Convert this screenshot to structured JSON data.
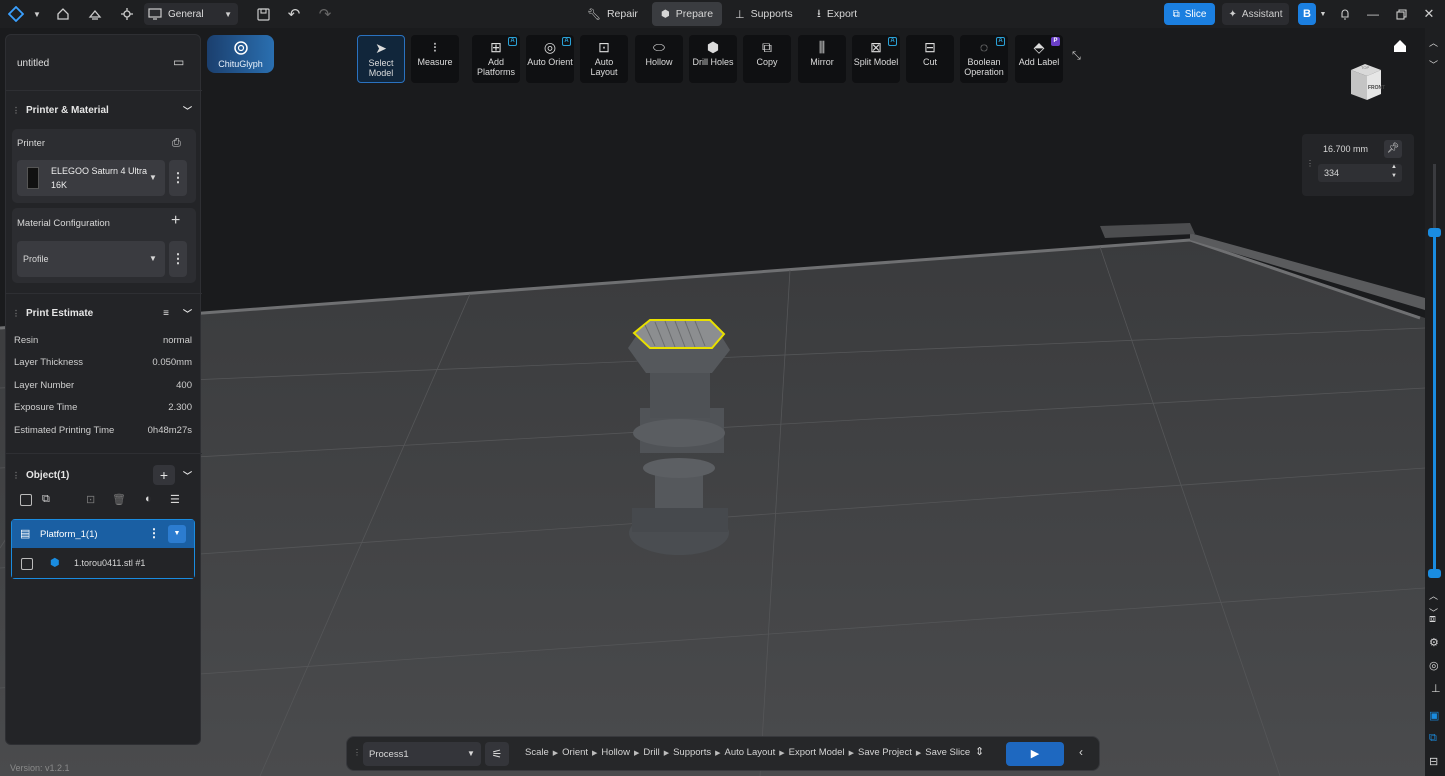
{
  "topbar": {
    "workspace": "General",
    "tabs": [
      "Repair",
      "Prepare",
      "Supports",
      "Export"
    ],
    "active_tab": "Prepare",
    "slice_label": "Slice",
    "assistant_label": "Assistant"
  },
  "chitu_label": "ChituGlyph",
  "toolbar": [
    {
      "label": "Select Model",
      "icon": "cursor-icon"
    },
    {
      "label": "Measure",
      "icon": "ruler-icon"
    },
    {
      "label": "Add Platforms",
      "icon": "platform-icon",
      "badge": "A"
    },
    {
      "label": "Auto Orient",
      "icon": "orient-icon",
      "badge": "A"
    },
    {
      "label": "Auto Layout",
      "icon": "layout-icon"
    },
    {
      "label": "Hollow",
      "icon": "hollow-icon"
    },
    {
      "label": "Drill Holes",
      "icon": "drill-icon"
    },
    {
      "label": "Copy",
      "icon": "copy-icon"
    },
    {
      "label": "Mirror",
      "icon": "mirror-icon"
    },
    {
      "label": "Split Model",
      "icon": "split-icon",
      "badge": "A"
    },
    {
      "label": "Cut",
      "icon": "cut-icon"
    },
    {
      "label": "Boolean Operation",
      "icon": "boolean-icon",
      "badge": "A"
    },
    {
      "label": "Add Label",
      "icon": "label-icon",
      "badge": "P"
    }
  ],
  "panel": {
    "project_name": "untitled",
    "printer_material_title": "Printer & Material",
    "printer_label": "Printer",
    "printer_name_line1": "ELEGOO Saturn 4 Ultra",
    "printer_name_line2": "16K",
    "material_config_label": "Material Configuration",
    "profile": "Profile",
    "print_estimate_title": "Print Estimate",
    "estimates": [
      {
        "label": "Resin",
        "value": "normal"
      },
      {
        "label": "Layer Thickness",
        "value": "0.050mm"
      },
      {
        "label": "Layer Number",
        "value": "400"
      },
      {
        "label": "Exposure Time",
        "value": "2.300"
      },
      {
        "label": "Estimated Printing Time",
        "value": "0h48m27s"
      }
    ],
    "objects_title": "Object(1)",
    "platform_label": "Platform_1(1)",
    "object_file": "1.torou0411.stl #1",
    "version": "Version: v1.2.1"
  },
  "layer_slider": {
    "height_value": "16.700 mm",
    "layer_value": "334",
    "level_fraction": 0.835
  },
  "view_cube": {
    "top": "TOP",
    "front": "FRONT"
  },
  "bottombar": {
    "process": "Process1",
    "steps": [
      "Scale",
      "Orient",
      "Hollow",
      "Drill",
      "Supports",
      "Auto Layout",
      "Export Model",
      "Save Project",
      "Save Slice"
    ]
  },
  "colors": {
    "accent": "#1a8ce0",
    "slice_button": "#1b7fe0",
    "selection": "#e8e000"
  }
}
